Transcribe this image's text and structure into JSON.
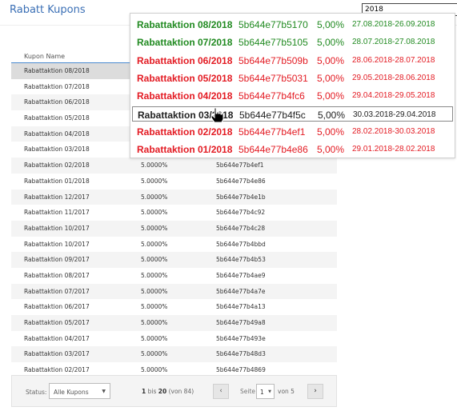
{
  "header": {
    "title": "Rabatt Kupons"
  },
  "search": {
    "value": "2018"
  },
  "table": {
    "column_header": "Kupon Name",
    "rows": [
      {
        "name": "Rabattaktion 08/2018",
        "discount": "",
        "code": ""
      },
      {
        "name": "Rabattaktion 07/2018",
        "discount": "",
        "code": ""
      },
      {
        "name": "Rabattaktion 06/2018",
        "discount": "",
        "code": ""
      },
      {
        "name": "Rabattaktion 05/2018",
        "discount": "",
        "code": ""
      },
      {
        "name": "Rabattaktion 04/2018",
        "discount": "",
        "code": ""
      },
      {
        "name": "Rabattaktion 03/2018",
        "discount": "",
        "code": ""
      },
      {
        "name": "Rabattaktion 02/2018",
        "discount": "5.0000%",
        "code": "5b644e77b4ef1"
      },
      {
        "name": "Rabattaktion 01/2018",
        "discount": "5.0000%",
        "code": "5b644e77b4e86"
      },
      {
        "name": "Rabattaktion 12/2017",
        "discount": "5.0000%",
        "code": "5b644e77b4e1b"
      },
      {
        "name": "Rabattaktion 11/2017",
        "discount": "5.0000%",
        "code": "5b644e77b4c92"
      },
      {
        "name": "Rabattaktion 10/2017",
        "discount": "5.0000%",
        "code": "5b644e77b4c28"
      },
      {
        "name": "Rabattaktion 10/2017",
        "discount": "5.0000%",
        "code": "5b644e77b4bbd"
      },
      {
        "name": "Rabattaktion 09/2017",
        "discount": "5.0000%",
        "code": "5b644e77b4b53"
      },
      {
        "name": "Rabattaktion 08/2017",
        "discount": "5.0000%",
        "code": "5b644e77b4ae9"
      },
      {
        "name": "Rabattaktion 07/2017",
        "discount": "5.0000%",
        "code": "5b644e77b4a7e"
      },
      {
        "name": "Rabattaktion 06/2017",
        "discount": "5.0000%",
        "code": "5b644e77b4a13"
      },
      {
        "name": "Rabattaktion 05/2017",
        "discount": "5.0000%",
        "code": "5b644e77b49a8"
      },
      {
        "name": "Rabattaktion 04/2017",
        "discount": "5.0000%",
        "code": "5b644e77b493e"
      },
      {
        "name": "Rabattaktion 03/2017",
        "discount": "5.0000%",
        "code": "5b644e77b48d3"
      },
      {
        "name": "Rabattaktion 02/2017",
        "discount": "5.0000%",
        "code": "5b644e77b4869"
      }
    ]
  },
  "footer": {
    "status_label": "Status:",
    "status_value": "Alle Kupons",
    "range_from": "1",
    "range_bis": "bis",
    "range_to": "20",
    "range_total": "(von 84)",
    "prev": "‹",
    "seite_label": "Seite",
    "page_value": "1",
    "page_total": "von 5",
    "next": "›"
  },
  "autocomplete": {
    "colors": {
      "green": "#218a21",
      "red": "#e31b23",
      "black": "#222222"
    },
    "options": [
      {
        "name": "Rabattaktion 08/2018",
        "code": "5b644e77b5170",
        "percent": "5,00%",
        "dates": "27.08.2018-26.09.2018",
        "color": "green"
      },
      {
        "name": "Rabattaktion 07/2018",
        "code": "5b644e77b5105",
        "percent": "5,00%",
        "dates": "28.07.2018-27.08.2018",
        "color": "green"
      },
      {
        "name": "Rabattaktion 06/2018",
        "code": "5b644e77b509b",
        "percent": "5,00%",
        "dates": "28.06.2018-28.07.2018",
        "color": "red"
      },
      {
        "name": "Rabattaktion 05/2018",
        "code": "5b644e77b5031",
        "percent": "5,00%",
        "dates": "29.05.2018-28.06.2018",
        "color": "red"
      },
      {
        "name": "Rabattaktion 04/2018",
        "code": "5b644e77b4fc6",
        "percent": "5,00%",
        "dates": "29.04.2018-29.05.2018",
        "color": "red"
      },
      {
        "name": "Rabattaktion 03/2018",
        "code": "5b644e77b4f5c",
        "percent": "5,00%",
        "dates": "30.03.2018-29.04.2018",
        "color": "black",
        "selected": true
      },
      {
        "name": "Rabattaktion 02/2018",
        "code": "5b644e77b4ef1",
        "percent": "5,00%",
        "dates": "28.02.2018-30.03.2018",
        "color": "red"
      },
      {
        "name": "Rabattaktion 01/2018",
        "code": "5b644e77b4e86",
        "percent": "5,00%",
        "dates": "29.01.2018-28.02.2018",
        "color": "red"
      }
    ]
  },
  "icons": {
    "cursor": "hand-pointer-icon",
    "select_caret": "caret-down-icon",
    "prev": "chevron-left-icon",
    "next": "chevron-right-icon"
  }
}
